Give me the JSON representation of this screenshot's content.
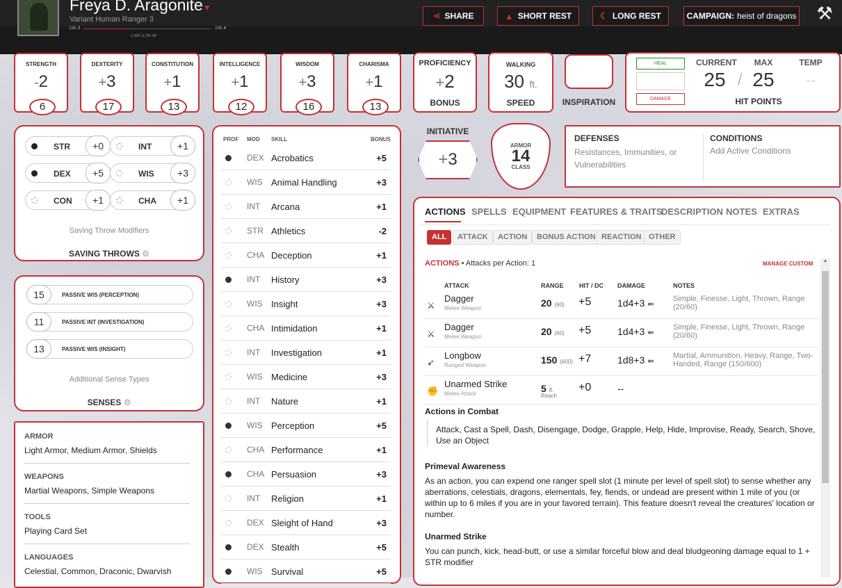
{
  "character": {
    "name": "Freya D. Aragonite",
    "subtitle": "Variant Human  Ranger 3",
    "level_current": "LVL 3",
    "level_next": "LVL 4",
    "xp": "1,349 / 2,700 XP",
    "xp_progress": 0.36
  },
  "header": {
    "share": "SHARE",
    "short_rest": "SHORT REST",
    "long_rest": "LONG REST",
    "campaign_label": "CAMPAIGN:",
    "campaign_name": "heist of dragons"
  },
  "abilities": [
    {
      "label": "STRENGTH",
      "sign": "-",
      "value": "2",
      "score": "6"
    },
    {
      "label": "DEXTERITY",
      "sign": "+",
      "value": "3",
      "score": "17"
    },
    {
      "label": "CONSTITUTION",
      "sign": "+",
      "value": "1",
      "score": "13"
    },
    {
      "label": "INTELLIGENCE",
      "sign": "+",
      "value": "1",
      "score": "12"
    },
    {
      "label": "WISDOM",
      "sign": "+",
      "value": "3",
      "score": "16"
    },
    {
      "label": "CHARISMA",
      "sign": "+",
      "value": "1",
      "score": "13"
    }
  ],
  "proficiency": {
    "label": "PROFICIENCY",
    "sign": "+",
    "value": "2",
    "sub": "BONUS"
  },
  "speed": {
    "label": "WALKING",
    "value": "30",
    "unit": "ft.",
    "sub": "SPEED"
  },
  "inspiration": {
    "label": "INSPIRATION"
  },
  "hp": {
    "heal": "HEAL",
    "damage": "DAMAGE",
    "current_label": "CURRENT",
    "max_label": "MAX",
    "temp_label": "TEMP",
    "current": "25",
    "max": "25",
    "temp": "--",
    "title": "HIT POINTS"
  },
  "initiative": {
    "label": "INITIATIVE",
    "sign": "+",
    "value": "3"
  },
  "armor": {
    "top": "ARMOR",
    "value": "14",
    "bottom": "CLASS"
  },
  "defenses": {
    "title": "DEFENSES",
    "text": "Resistances, Immunities, or Vulnerabilities"
  },
  "conditions": {
    "title": "CONDITIONS",
    "text": "Add Active Conditions"
  },
  "saving_throws": {
    "rows": [
      {
        "name": "STR",
        "bonus": "+0",
        "prof": true
      },
      {
        "name": "INT",
        "bonus": "+1",
        "prof": false
      },
      {
        "name": "DEX",
        "bonus": "+5",
        "prof": true
      },
      {
        "name": "WIS",
        "bonus": "+3",
        "prof": false
      },
      {
        "name": "CON",
        "bonus": "+1",
        "prof": false
      },
      {
        "name": "CHA",
        "bonus": "+1",
        "prof": false
      }
    ],
    "caption": "Saving Throw Modifiers",
    "title": "SAVING THROWS"
  },
  "senses": {
    "rows": [
      {
        "value": "15",
        "label": "PASSIVE WIS (PERCEPTION)"
      },
      {
        "value": "11",
        "label": "PASSIVE INT (INVESTIGATION)"
      },
      {
        "value": "13",
        "label": "PASSIVE WIS (INSIGHT)"
      }
    ],
    "caption": "Additional Sense Types",
    "title": "SENSES"
  },
  "proficiencies": {
    "armor_h": "ARMOR",
    "armor": "Light Armor, Medium Armor, Shields",
    "weapons_h": "WEAPONS",
    "weapons": "Martial Weapons, Simple Weapons",
    "tools_h": "TOOLS",
    "tools": "Playing Card Set",
    "languages_h": "LANGUAGES",
    "languages": "Celestial, Common, Draconic, Dwarvish"
  },
  "skills": {
    "headers": {
      "prof": "PROF",
      "mod": "MOD",
      "skill": "SKILL",
      "bonus": "BONUS"
    },
    "rows": [
      {
        "prof": true,
        "mod": "DEX",
        "name": "Acrobatics",
        "bonus": "+5"
      },
      {
        "prof": false,
        "mod": "WIS",
        "name": "Animal Handling",
        "bonus": "+3"
      },
      {
        "prof": false,
        "mod": "INT",
        "name": "Arcana",
        "bonus": "+1"
      },
      {
        "prof": false,
        "mod": "STR",
        "name": "Athletics",
        "bonus": "-2"
      },
      {
        "prof": false,
        "mod": "CHA",
        "name": "Deception",
        "bonus": "+1"
      },
      {
        "prof": true,
        "mod": "INT",
        "name": "History",
        "bonus": "+3"
      },
      {
        "prof": false,
        "mod": "WIS",
        "name": "Insight",
        "bonus": "+3"
      },
      {
        "prof": false,
        "mod": "CHA",
        "name": "Intimidation",
        "bonus": "+1"
      },
      {
        "prof": false,
        "mod": "INT",
        "name": "Investigation",
        "bonus": "+1"
      },
      {
        "prof": false,
        "mod": "WIS",
        "name": "Medicine",
        "bonus": "+3"
      },
      {
        "prof": false,
        "mod": "INT",
        "name": "Nature",
        "bonus": "+1"
      },
      {
        "prof": true,
        "mod": "WIS",
        "name": "Perception",
        "bonus": "+5"
      },
      {
        "prof": false,
        "mod": "CHA",
        "name": "Performance",
        "bonus": "+1"
      },
      {
        "prof": true,
        "mod": "CHA",
        "name": "Persuasion",
        "bonus": "+3"
      },
      {
        "prof": false,
        "mod": "INT",
        "name": "Religion",
        "bonus": "+1"
      },
      {
        "prof": false,
        "mod": "DEX",
        "name": "Sleight of Hand",
        "bonus": "+3"
      },
      {
        "prof": true,
        "mod": "DEX",
        "name": "Stealth",
        "bonus": "+5"
      },
      {
        "prof": true,
        "mod": "WIS",
        "name": "Survival",
        "bonus": "+5"
      }
    ]
  },
  "tabs": [
    "ACTIONS",
    "SPELLS",
    "EQUIPMENT",
    "FEATURES & TRAITS",
    "DESCRIPTION",
    "NOTES",
    "EXTRAS"
  ],
  "filters": [
    "ALL",
    "ATTACK",
    "ACTION",
    "BONUS ACTION",
    "REACTION",
    "OTHER"
  ],
  "actions": {
    "title": "ACTIONS",
    "per": "• Attacks per Action: 1",
    "manage": "MANAGE CUSTOM",
    "headers": {
      "attack": "ATTACK",
      "range": "RANGE",
      "hit": "HIT / DC",
      "damage": "DAMAGE",
      "notes": "NOTES"
    },
    "rows": [
      {
        "name": "Dagger",
        "type": "Melee Weapon",
        "range": "20",
        "range2": "(60)",
        "hit": "+5",
        "damage": "1d4+3",
        "notes": "Simple, Finesse, Light, Thrown, Range (20/60)",
        "icon": "sword-icon"
      },
      {
        "name": "Dagger",
        "type": "Melee Weapon",
        "range": "20",
        "range2": "(60)",
        "hit": "+5",
        "damage": "1d4+3",
        "notes": "Simple, Finesse, Light, Thrown, Range (20/60)",
        "icon": "sword-icon"
      },
      {
        "name": "Longbow",
        "type": "Ranged Weapon",
        "range": "150",
        "range2": "(600)",
        "hit": "+7",
        "damage": "1d8+3",
        "notes": "Martial, Ammunition, Heavy, Range, Two-Handed, Range (150/600)",
        "icon": "bow-icon"
      },
      {
        "name": "Unarmed Strike",
        "type": "Melee Attack",
        "range": "5",
        "range2": "ft.",
        "range3": "Reach",
        "hit": "+0",
        "damage": "--",
        "notes": "",
        "icon": "fist-icon"
      }
    ],
    "combat_title": "Actions in Combat",
    "combat_text": "Attack, Cast a Spell, Dash, Disengage, Dodge, Grapple, Help, Hide, Improvise, Ready, Search, Shove, Use an Object",
    "primeval_title": "Primeval Awareness",
    "primeval_text": "As an action, you can expend one ranger spell slot (1 minute per level of spell slot) to sense whether any aberrations, celestials, dragons, elementals, fey, fiends, or undead are present within 1 mile of you (or within up to 6 miles if you are in your favored terrain). This feature doesn't reveal the creatures' location or number.",
    "unarmed_title": "Unarmed Strike",
    "unarmed_text": "You can punch, kick, head-butt, or use a similar forceful blow and deal bludgeoning damage equal to 1 + STR modifier"
  }
}
